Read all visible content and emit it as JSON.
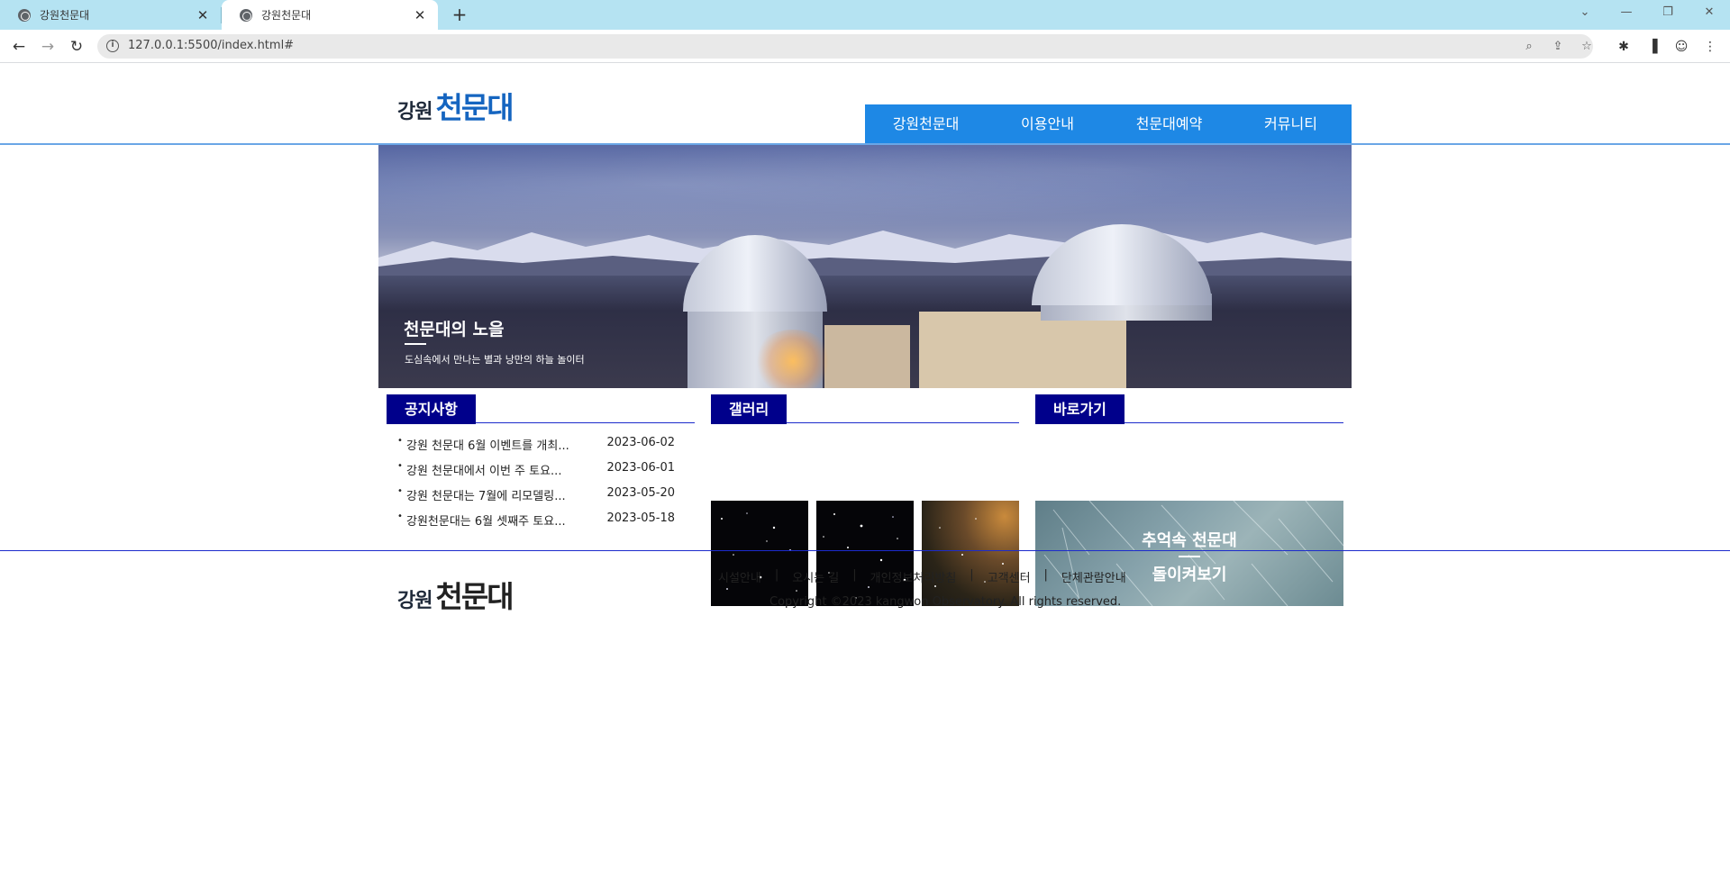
{
  "browser": {
    "tabs": [
      {
        "title": "강원천문대",
        "active": false
      },
      {
        "title": "강원천문대",
        "active": true
      }
    ],
    "new_tab": "+",
    "url": "127.0.0.1:5500/index.html#",
    "icons": [
      "back-arrow",
      "forward-arrow",
      "reload",
      "info",
      "zoom",
      "share",
      "star",
      "extensions",
      "sidepanel",
      "profile",
      "menu"
    ]
  },
  "site": {
    "logo_small": "강원",
    "logo_big": "천문대",
    "nav": [
      "강원천문대",
      "이용안내",
      "천문대예약",
      "커뮤니티"
    ],
    "hero": {
      "title": "천문대의 노을",
      "subtitle": "도심속에서 만나는 별과 낭만의 하늘 놀이터"
    },
    "sections": {
      "notice": {
        "heading": "공지사항",
        "items": [
          {
            "title": "강원 천문대 6월 이벤트를 개최...",
            "date": "2023-06-02"
          },
          {
            "title": "강원 천문대에서 이번 주 토요...",
            "date": "2023-06-01"
          },
          {
            "title": "강원 천문대는 7월에 리모델링...",
            "date": "2023-05-20"
          },
          {
            "title": "강원천문대는 6월 셋째주 토요...",
            "date": "2023-05-18"
          }
        ]
      },
      "gallery": {
        "heading": "갤러리"
      },
      "shortcut": {
        "heading": "바로가기",
        "line1": "추억속 천문대",
        "line2": "돌이켜보기"
      }
    },
    "footer": {
      "links": [
        "시설안내",
        "오시는 길",
        "개인정보처리방침",
        "고객센터",
        "단체관람안내"
      ],
      "separator": "|",
      "copyright": "Copyright ©2023 kangwon Observatory. All rights reserved."
    }
  }
}
